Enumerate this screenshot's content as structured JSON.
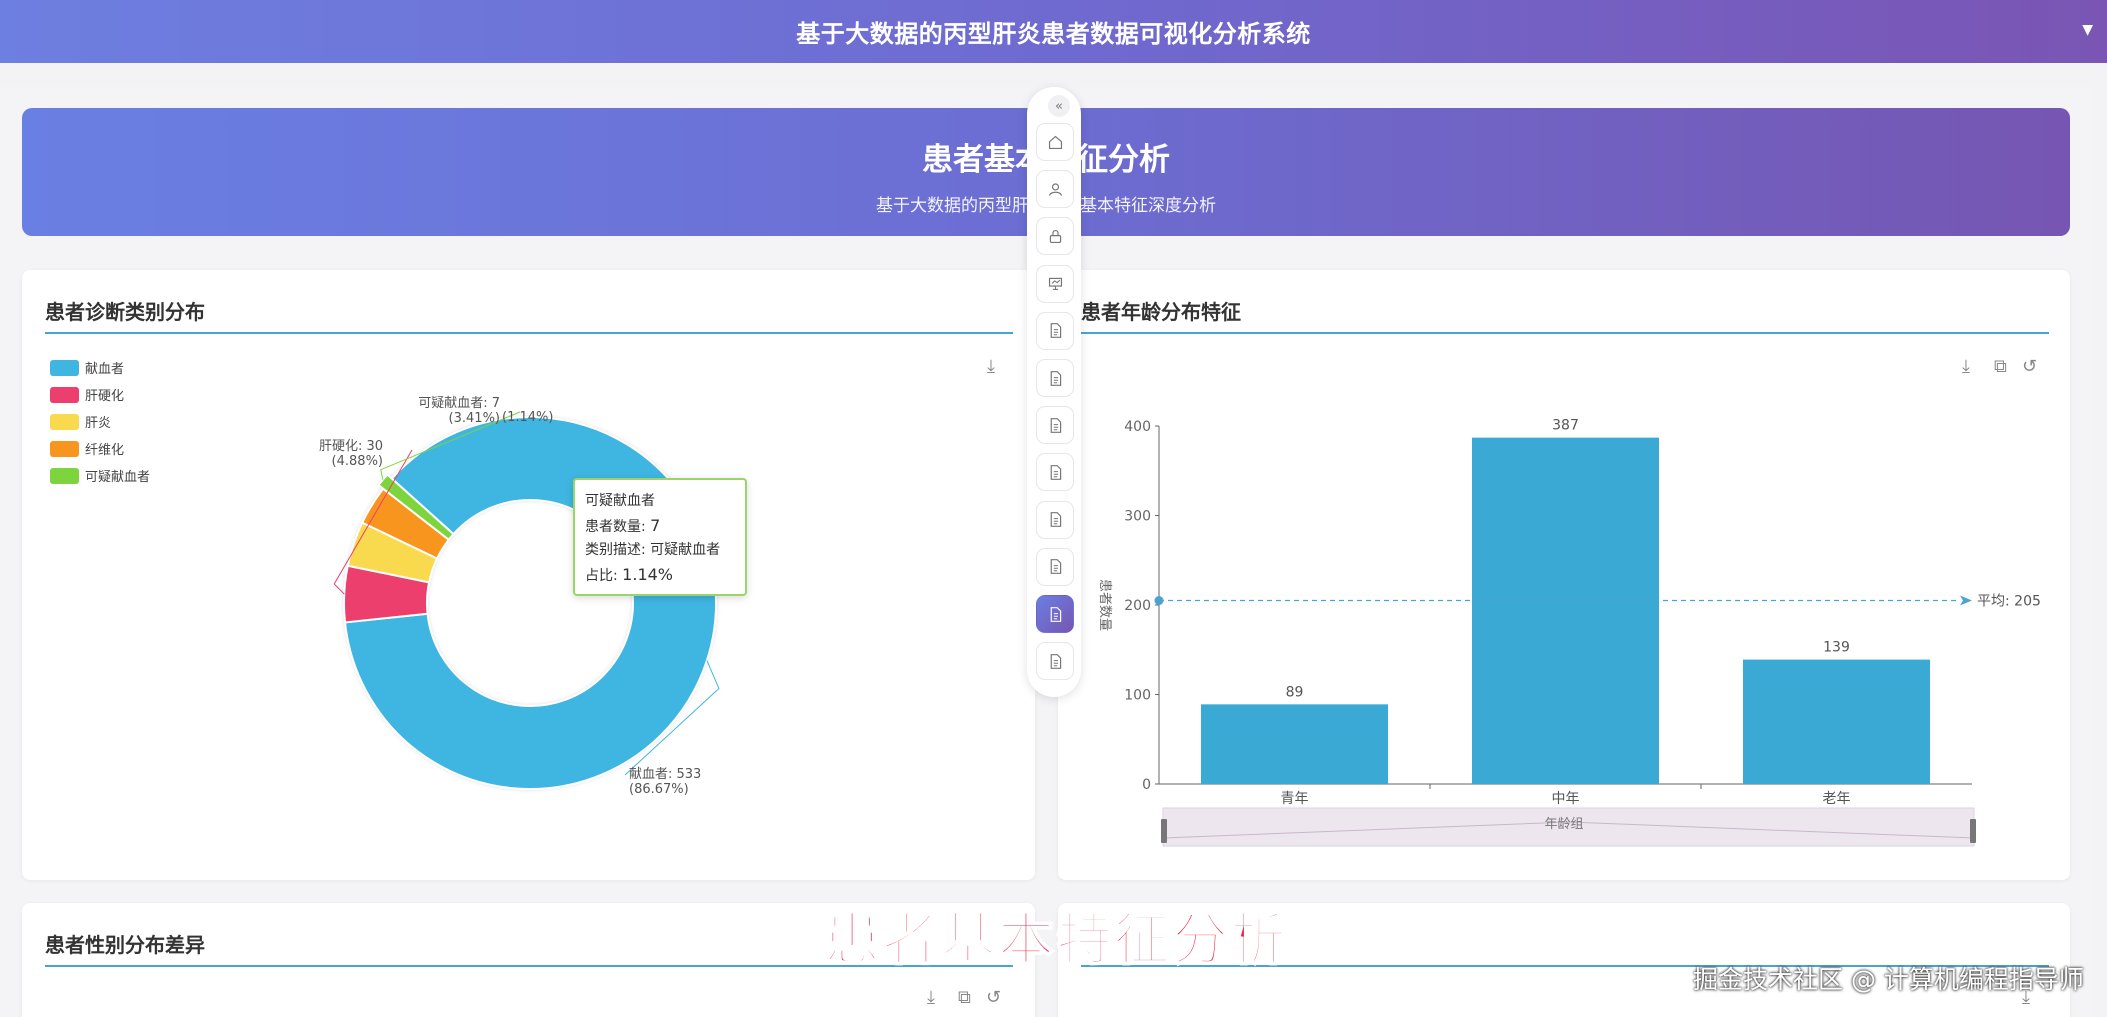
{
  "app": {
    "title": "基于大数据的丙型肝炎患者数据可视化分析系统"
  },
  "banner": {
    "title": "患者基本特征分析",
    "subtitle": "基于大数据的丙型肝炎患者基本特征深度分析"
  },
  "cards": {
    "diagnosis": {
      "title": "患者诊断类别分布"
    },
    "age": {
      "title": "患者年龄分布特征"
    },
    "gender": {
      "title": "患者性别分布差异"
    }
  },
  "tooltip": {
    "name": "可疑献血者",
    "count_label": "患者数量: ",
    "count": "7",
    "desc_label": "类别描述: ",
    "desc": "可疑献血者",
    "ratio_label": "占比: ",
    "ratio": "1.14%"
  },
  "chart_data": [
    {
      "type": "pie",
      "donut": true,
      "categories": [
        "献血者",
        "肝硬化",
        "肝炎",
        "纤维化",
        "可疑献血者"
      ],
      "values": [
        533,
        30,
        24,
        21,
        7
      ],
      "percents": [
        "86.67%",
        "4.88%",
        "3.9%",
        "3.41%",
        "1.14%"
      ],
      "labels": [
        "献血者: 533",
        "肝硬化: 30",
        "可疑献血者: 7"
      ],
      "label_percents": [
        "(86.67%)",
        "(4.88%)",
        "(3.41%)",
        "(1.14%)"
      ],
      "colors": [
        "#3fb5e2",
        "#ec3f6e",
        "#f9d94d",
        "#f7951e",
        "#7dd43d"
      ],
      "legend_position": "top-left"
    },
    {
      "type": "bar",
      "categories": [
        "青年",
        "中年",
        "老年"
      ],
      "values": [
        89,
        387,
        139
      ],
      "ylabel": "患者数量",
      "xlabel": "年龄组",
      "ylim": [
        0,
        400
      ],
      "yticks": [
        "400",
        "300",
        "200",
        "100",
        "0"
      ],
      "average": 205,
      "average_label": "平均: 205",
      "bar_color": "#3aa9d4",
      "data_zoom": true
    }
  ],
  "sidebar": {
    "active_index": 10,
    "button_count": 12
  },
  "overlay": {
    "caption": "患者基本特征分析",
    "watermark": "掘金技术社区 @ 计算机编程指导师"
  }
}
